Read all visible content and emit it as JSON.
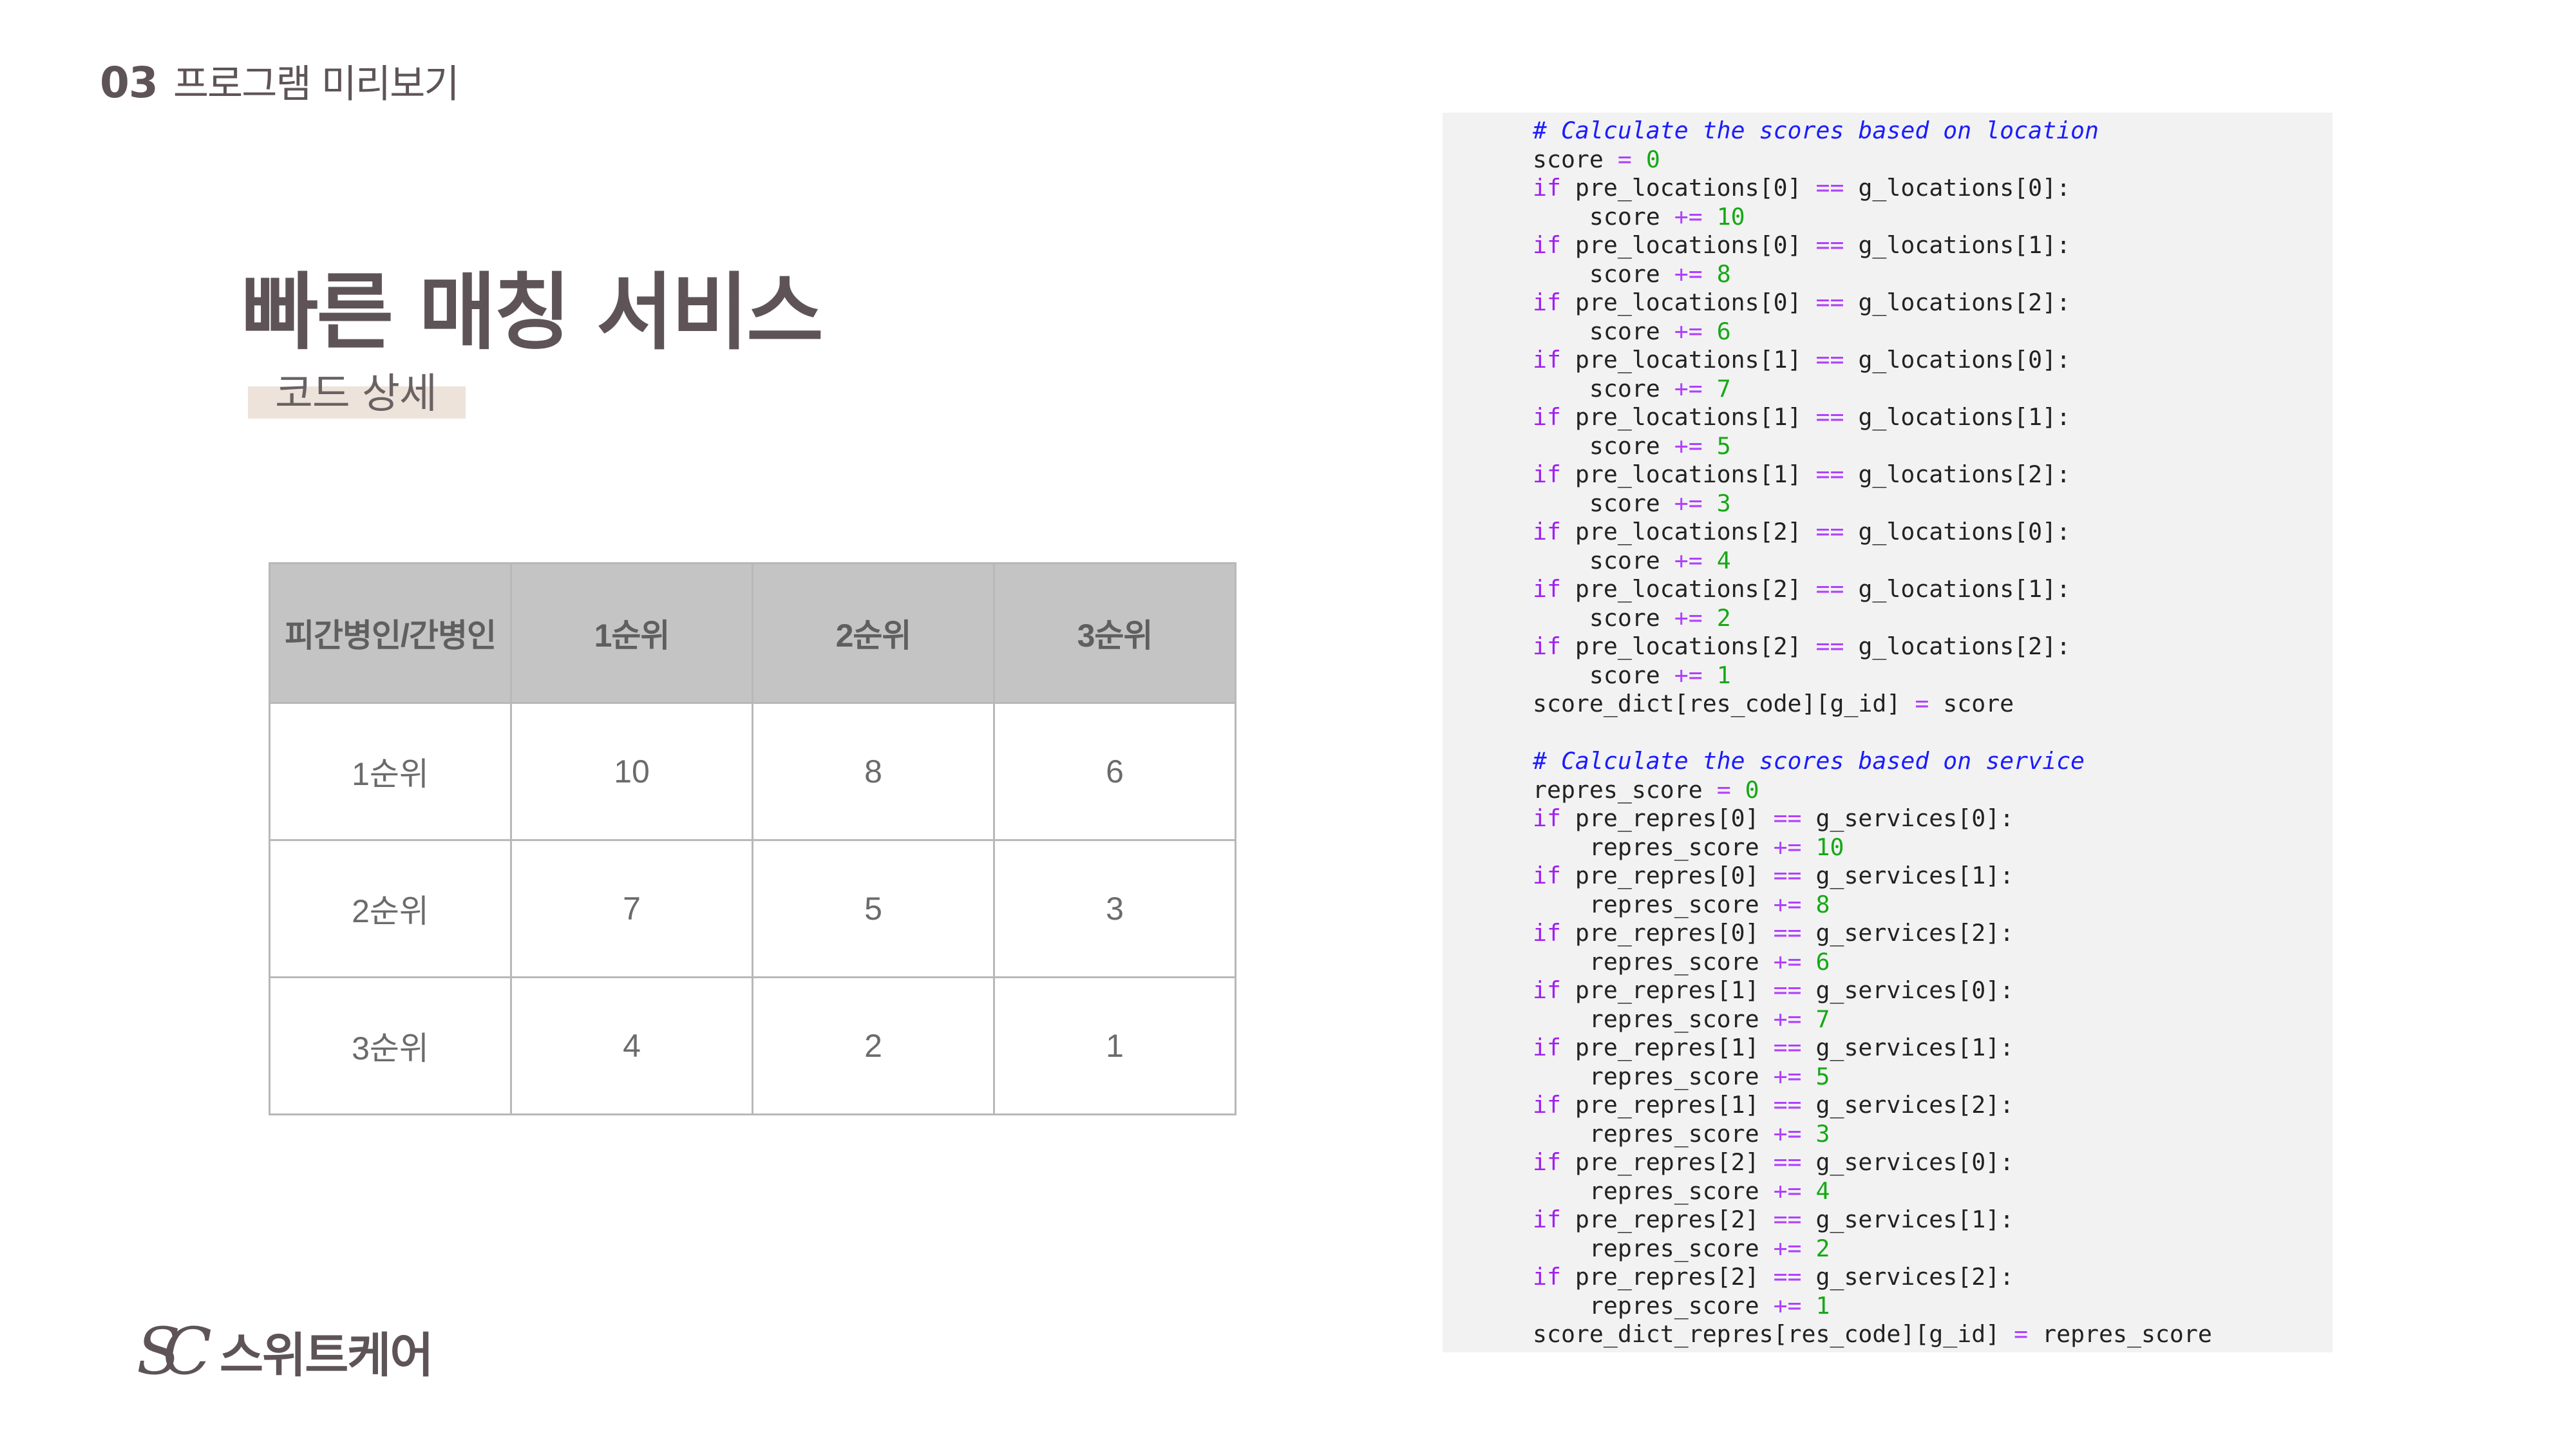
{
  "header": {
    "number": "03",
    "title": "프로그램 미리보기"
  },
  "main": {
    "title": "빠른 매칭 서비스",
    "subtitle": "코드 상세"
  },
  "table": {
    "headers": [
      "피간병인/간병인",
      "1순위",
      "2순위",
      "3순위"
    ],
    "rows": [
      [
        "1순위",
        "10",
        "8",
        "6"
      ],
      [
        "2순위",
        "7",
        "5",
        "3"
      ],
      [
        "3순위",
        "4",
        "2",
        "1"
      ]
    ]
  },
  "code": {
    "lines": [
      [
        [
          "cm",
          "# Calculate the scores based on location"
        ]
      ],
      [
        [
          "",
          "score "
        ],
        [
          "op",
          "="
        ],
        [
          "",
          " "
        ],
        [
          "nm",
          "0"
        ]
      ],
      [
        [
          "kw",
          "if"
        ],
        [
          "",
          " pre_locations[0] "
        ],
        [
          "op",
          "=="
        ],
        [
          "",
          " g_locations[0]:"
        ]
      ],
      [
        [
          "",
          "    score "
        ],
        [
          "op",
          "+="
        ],
        [
          "",
          " "
        ],
        [
          "nm",
          "10"
        ]
      ],
      [
        [
          "kw",
          "if"
        ],
        [
          "",
          " pre_locations[0] "
        ],
        [
          "op",
          "=="
        ],
        [
          "",
          " g_locations[1]:"
        ]
      ],
      [
        [
          "",
          "    score "
        ],
        [
          "op",
          "+="
        ],
        [
          "",
          " "
        ],
        [
          "nm",
          "8"
        ]
      ],
      [
        [
          "kw",
          "if"
        ],
        [
          "",
          " pre_locations[0] "
        ],
        [
          "op",
          "=="
        ],
        [
          "",
          " g_locations[2]:"
        ]
      ],
      [
        [
          "",
          "    score "
        ],
        [
          "op",
          "+="
        ],
        [
          "",
          " "
        ],
        [
          "nm",
          "6"
        ]
      ],
      [
        [
          "kw",
          "if"
        ],
        [
          "",
          " pre_locations[1] "
        ],
        [
          "op",
          "=="
        ],
        [
          "",
          " g_locations[0]:"
        ]
      ],
      [
        [
          "",
          "    score "
        ],
        [
          "op",
          "+="
        ],
        [
          "",
          " "
        ],
        [
          "nm",
          "7"
        ]
      ],
      [
        [
          "kw",
          "if"
        ],
        [
          "",
          " pre_locations[1] "
        ],
        [
          "op",
          "=="
        ],
        [
          "",
          " g_locations[1]:"
        ]
      ],
      [
        [
          "",
          "    score "
        ],
        [
          "op",
          "+="
        ],
        [
          "",
          " "
        ],
        [
          "nm",
          "5"
        ]
      ],
      [
        [
          "kw",
          "if"
        ],
        [
          "",
          " pre_locations[1] "
        ],
        [
          "op",
          "=="
        ],
        [
          "",
          " g_locations[2]:"
        ]
      ],
      [
        [
          "",
          "    score "
        ],
        [
          "op",
          "+="
        ],
        [
          "",
          " "
        ],
        [
          "nm",
          "3"
        ]
      ],
      [
        [
          "kw",
          "if"
        ],
        [
          "",
          " pre_locations[2] "
        ],
        [
          "op",
          "=="
        ],
        [
          "",
          " g_locations[0]:"
        ]
      ],
      [
        [
          "",
          "    score "
        ],
        [
          "op",
          "+="
        ],
        [
          "",
          " "
        ],
        [
          "nm",
          "4"
        ]
      ],
      [
        [
          "kw",
          "if"
        ],
        [
          "",
          " pre_locations[2] "
        ],
        [
          "op",
          "=="
        ],
        [
          "",
          " g_locations[1]:"
        ]
      ],
      [
        [
          "",
          "    score "
        ],
        [
          "op",
          "+="
        ],
        [
          "",
          " "
        ],
        [
          "nm",
          "2"
        ]
      ],
      [
        [
          "kw",
          "if"
        ],
        [
          "",
          " pre_locations[2] "
        ],
        [
          "op",
          "=="
        ],
        [
          "",
          " g_locations[2]:"
        ]
      ],
      [
        [
          "",
          "    score "
        ],
        [
          "op",
          "+="
        ],
        [
          "",
          " "
        ],
        [
          "nm",
          "1"
        ]
      ],
      [
        [
          "",
          "score_dict[res_code][g_id] "
        ],
        [
          "op",
          "="
        ],
        [
          "",
          " score"
        ]
      ],
      [
        [
          "",
          ""
        ]
      ],
      [
        [
          "cm",
          "# Calculate the scores based on service"
        ]
      ],
      [
        [
          "",
          "repres_score "
        ],
        [
          "op",
          "="
        ],
        [
          "",
          " "
        ],
        [
          "nm",
          "0"
        ]
      ],
      [
        [
          "kw",
          "if"
        ],
        [
          "",
          " pre_repres[0] "
        ],
        [
          "op",
          "=="
        ],
        [
          "",
          " g_services[0]:"
        ]
      ],
      [
        [
          "",
          "    repres_score "
        ],
        [
          "op",
          "+="
        ],
        [
          "",
          " "
        ],
        [
          "nm",
          "10"
        ]
      ],
      [
        [
          "kw",
          "if"
        ],
        [
          "",
          " pre_repres[0] "
        ],
        [
          "op",
          "=="
        ],
        [
          "",
          " g_services[1]:"
        ]
      ],
      [
        [
          "",
          "    repres_score "
        ],
        [
          "op",
          "+="
        ],
        [
          "",
          " "
        ],
        [
          "nm",
          "8"
        ]
      ],
      [
        [
          "kw",
          "if"
        ],
        [
          "",
          " pre_repres[0] "
        ],
        [
          "op",
          "=="
        ],
        [
          "",
          " g_services[2]:"
        ]
      ],
      [
        [
          "",
          "    repres_score "
        ],
        [
          "op",
          "+="
        ],
        [
          "",
          " "
        ],
        [
          "nm",
          "6"
        ]
      ],
      [
        [
          "kw",
          "if"
        ],
        [
          "",
          " pre_repres[1] "
        ],
        [
          "op",
          "=="
        ],
        [
          "",
          " g_services[0]:"
        ]
      ],
      [
        [
          "",
          "    repres_score "
        ],
        [
          "op",
          "+="
        ],
        [
          "",
          " "
        ],
        [
          "nm",
          "7"
        ]
      ],
      [
        [
          "kw",
          "if"
        ],
        [
          "",
          " pre_repres[1] "
        ],
        [
          "op",
          "=="
        ],
        [
          "",
          " g_services[1]:"
        ]
      ],
      [
        [
          "",
          "    repres_score "
        ],
        [
          "op",
          "+="
        ],
        [
          "",
          " "
        ],
        [
          "nm",
          "5"
        ]
      ],
      [
        [
          "kw",
          "if"
        ],
        [
          "",
          " pre_repres[1] "
        ],
        [
          "op",
          "=="
        ],
        [
          "",
          " g_services[2]:"
        ]
      ],
      [
        [
          "",
          "    repres_score "
        ],
        [
          "op",
          "+="
        ],
        [
          "",
          " "
        ],
        [
          "nm",
          "3"
        ]
      ],
      [
        [
          "kw",
          "if"
        ],
        [
          "",
          " pre_repres[2] "
        ],
        [
          "op",
          "=="
        ],
        [
          "",
          " g_services[0]:"
        ]
      ],
      [
        [
          "",
          "    repres_score "
        ],
        [
          "op",
          "+="
        ],
        [
          "",
          " "
        ],
        [
          "nm",
          "4"
        ]
      ],
      [
        [
          "kw",
          "if"
        ],
        [
          "",
          " pre_repres[2] "
        ],
        [
          "op",
          "=="
        ],
        [
          "",
          " g_services[1]:"
        ]
      ],
      [
        [
          "",
          "    repres_score "
        ],
        [
          "op",
          "+="
        ],
        [
          "",
          " "
        ],
        [
          "nm",
          "2"
        ]
      ],
      [
        [
          "kw",
          "if"
        ],
        [
          "",
          " pre_repres[2] "
        ],
        [
          "op",
          "=="
        ],
        [
          "",
          " g_services[2]:"
        ]
      ],
      [
        [
          "",
          "    repres_score "
        ],
        [
          "op",
          "+="
        ],
        [
          "",
          " "
        ],
        [
          "nm",
          "1"
        ]
      ],
      [
        [
          "",
          "score_dict_repres[res_code][g_id] "
        ],
        [
          "op",
          "="
        ],
        [
          "",
          " repres_score"
        ]
      ]
    ]
  },
  "logo": {
    "mark": "SC",
    "text": "스위트케어"
  }
}
